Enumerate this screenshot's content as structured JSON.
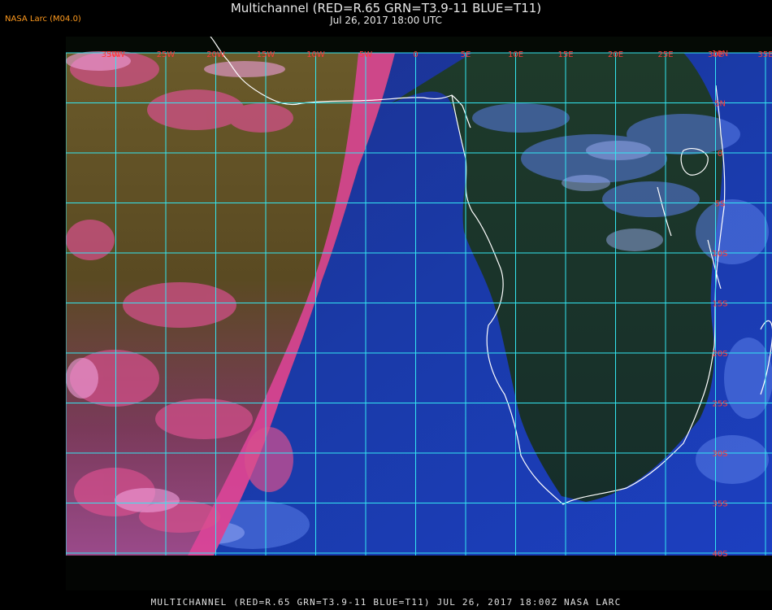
{
  "header": {
    "badge": "NASA Larc (M04.0)",
    "title": "Multichannel (RED=R.65 GRN=T3.9-11 BLUE=T11)",
    "subtitle": "Jul 26, 2017 18:00 UTC"
  },
  "footer": {
    "caption": "MULTICHANNEL  (RED=R.65 GRN=T3.9-11 BLUE=T11) JUL 26, 2017 18:00Z   NASA LARC"
  },
  "map": {
    "grid_color": "#33e6f0",
    "coast_color": "#ffffff",
    "label_color": "#ff3a3a",
    "lon_labels": [
      "35W",
      "30W",
      "25W",
      "20W",
      "15W",
      "10W",
      "5W",
      "0",
      "5E",
      "10E",
      "15E",
      "20E",
      "25E",
      "30E",
      "35E"
    ],
    "lat_labels": [
      "10N",
      "5N",
      "0",
      "5S",
      "10S",
      "15S",
      "20S",
      "25S",
      "30S",
      "35S",
      "40S"
    ]
  }
}
